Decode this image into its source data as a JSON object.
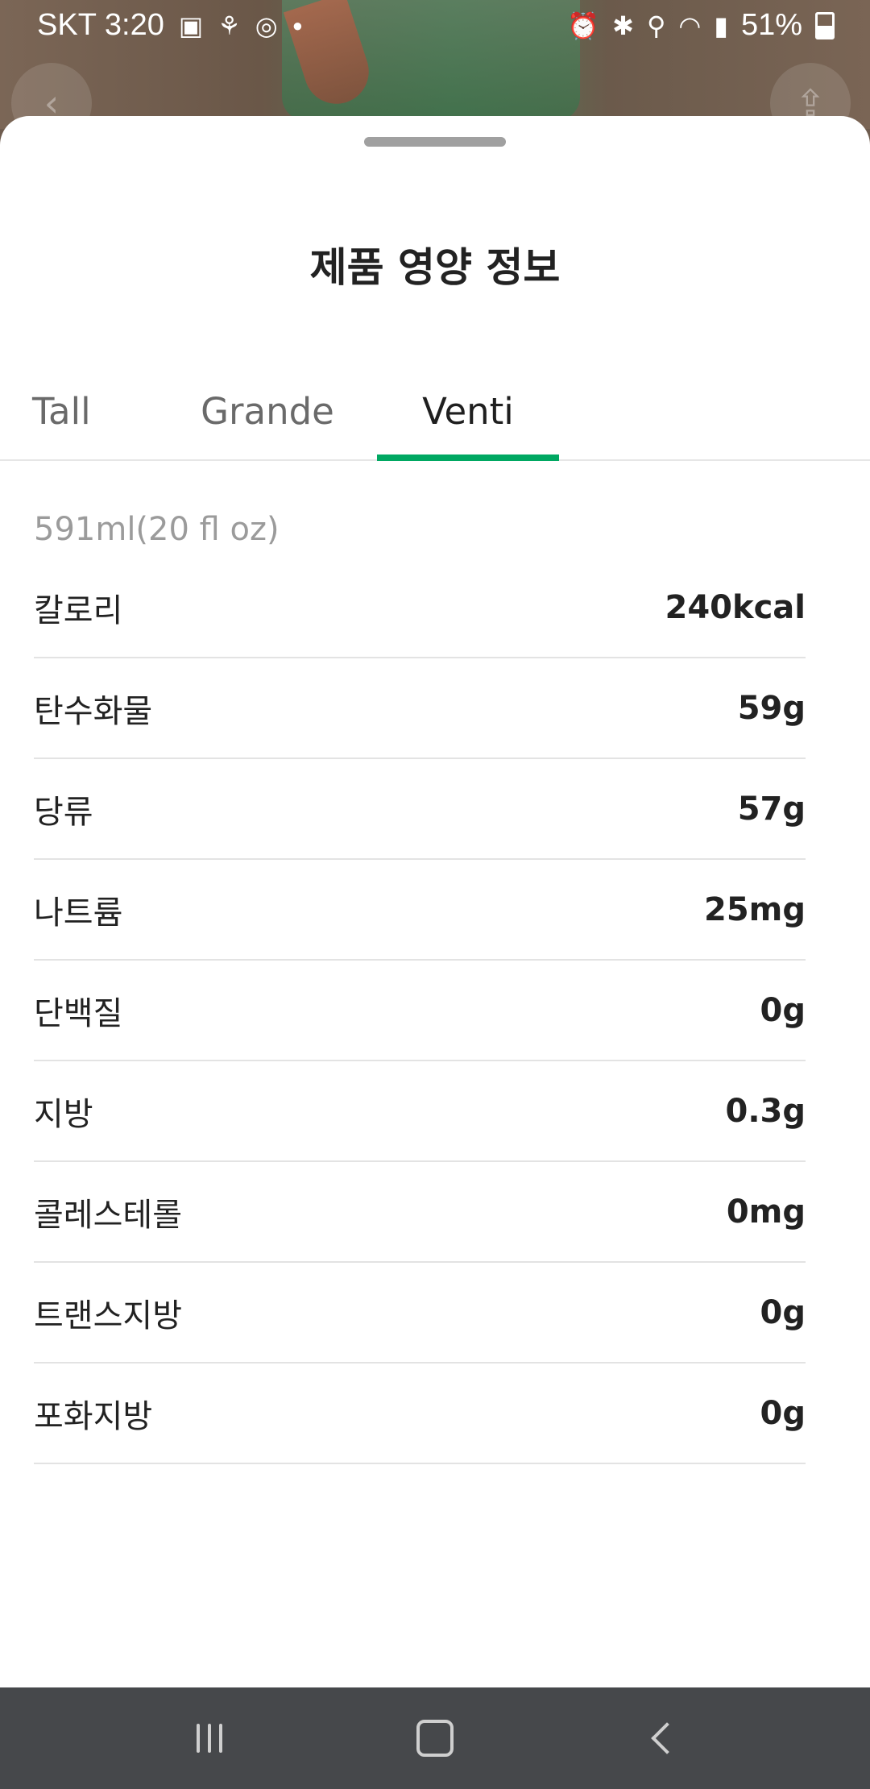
{
  "status_bar": {
    "carrier": "SKT",
    "time": "3:20",
    "battery": "51%",
    "left_icons": [
      "gallery-icon",
      "app-icon",
      "sync-icon",
      "dot-icon"
    ],
    "right_icons": [
      "alarm-icon",
      "bluetooth-icon",
      "location-icon",
      "wifi-icon",
      "signal-icon",
      "battery-icon"
    ]
  },
  "sheet": {
    "title": "제품 영양 정보",
    "tabs": [
      {
        "label": "Tall",
        "active": false
      },
      {
        "label": "Grande",
        "active": false
      },
      {
        "label": "Venti",
        "active": true
      }
    ],
    "accent_color": "#00a862",
    "size_text": "591ml(20 fl oz)",
    "nutrition": [
      {
        "label": "칼로리",
        "value": "240kcal"
      },
      {
        "label": "탄수화물",
        "value": "59g"
      },
      {
        "label": "당류",
        "value": "57g"
      },
      {
        "label": "나트륨",
        "value": "25mg"
      },
      {
        "label": "단백질",
        "value": "0g"
      },
      {
        "label": "지방",
        "value": "0.3g"
      },
      {
        "label": "콜레스테롤",
        "value": "0mg"
      },
      {
        "label": "트랜스지방",
        "value": "0g"
      },
      {
        "label": "포화지방",
        "value": "0g"
      }
    ]
  },
  "nav_bar": {
    "buttons": [
      "recents-icon",
      "home-icon",
      "back-icon"
    ]
  }
}
